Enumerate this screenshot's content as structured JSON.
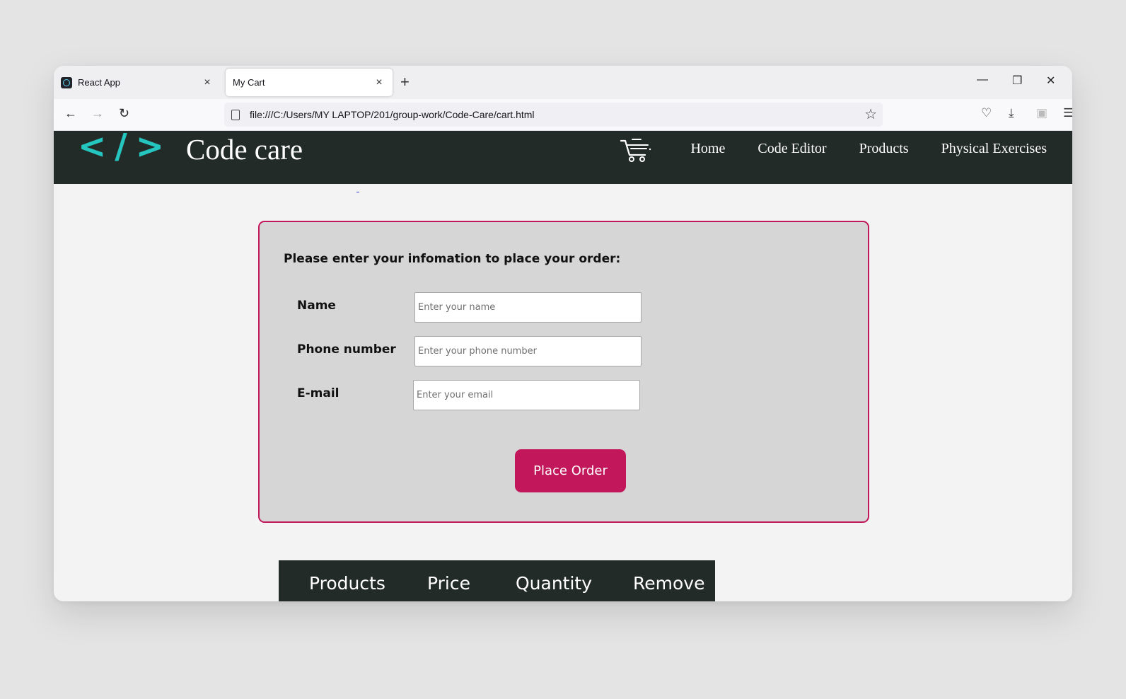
{
  "browser": {
    "tabs": [
      {
        "label": "React App",
        "active": false
      },
      {
        "label": "My Cart",
        "active": true
      }
    ],
    "new_tab_symbol": "+",
    "close_symbol": "×",
    "url": "file:///C:/Users/MY LAPTOP/201/group-work/Code-Care/cart.html"
  },
  "site": {
    "logo_mark": "</>",
    "title": "Code care",
    "nav": [
      "Home",
      "Code Editor",
      "Products",
      "Physical Exercises"
    ]
  },
  "order_form": {
    "heading": "Please enter your infomation to place your order:",
    "fields": [
      {
        "label": "Name",
        "placeholder": "Enter your name",
        "value": ""
      },
      {
        "label": "Phone number",
        "placeholder": "Enter your phone number",
        "value": ""
      },
      {
        "label": "E-mail",
        "placeholder": "Enter your email",
        "value": ""
      }
    ],
    "submit_label": "Place Order"
  },
  "cart_table": {
    "columns": [
      "Products",
      "Price",
      "Quantity",
      "Remove"
    ]
  },
  "colors": {
    "header_bg": "#232b29",
    "accent": "#c2185b",
    "logo": "#26c6c0"
  }
}
